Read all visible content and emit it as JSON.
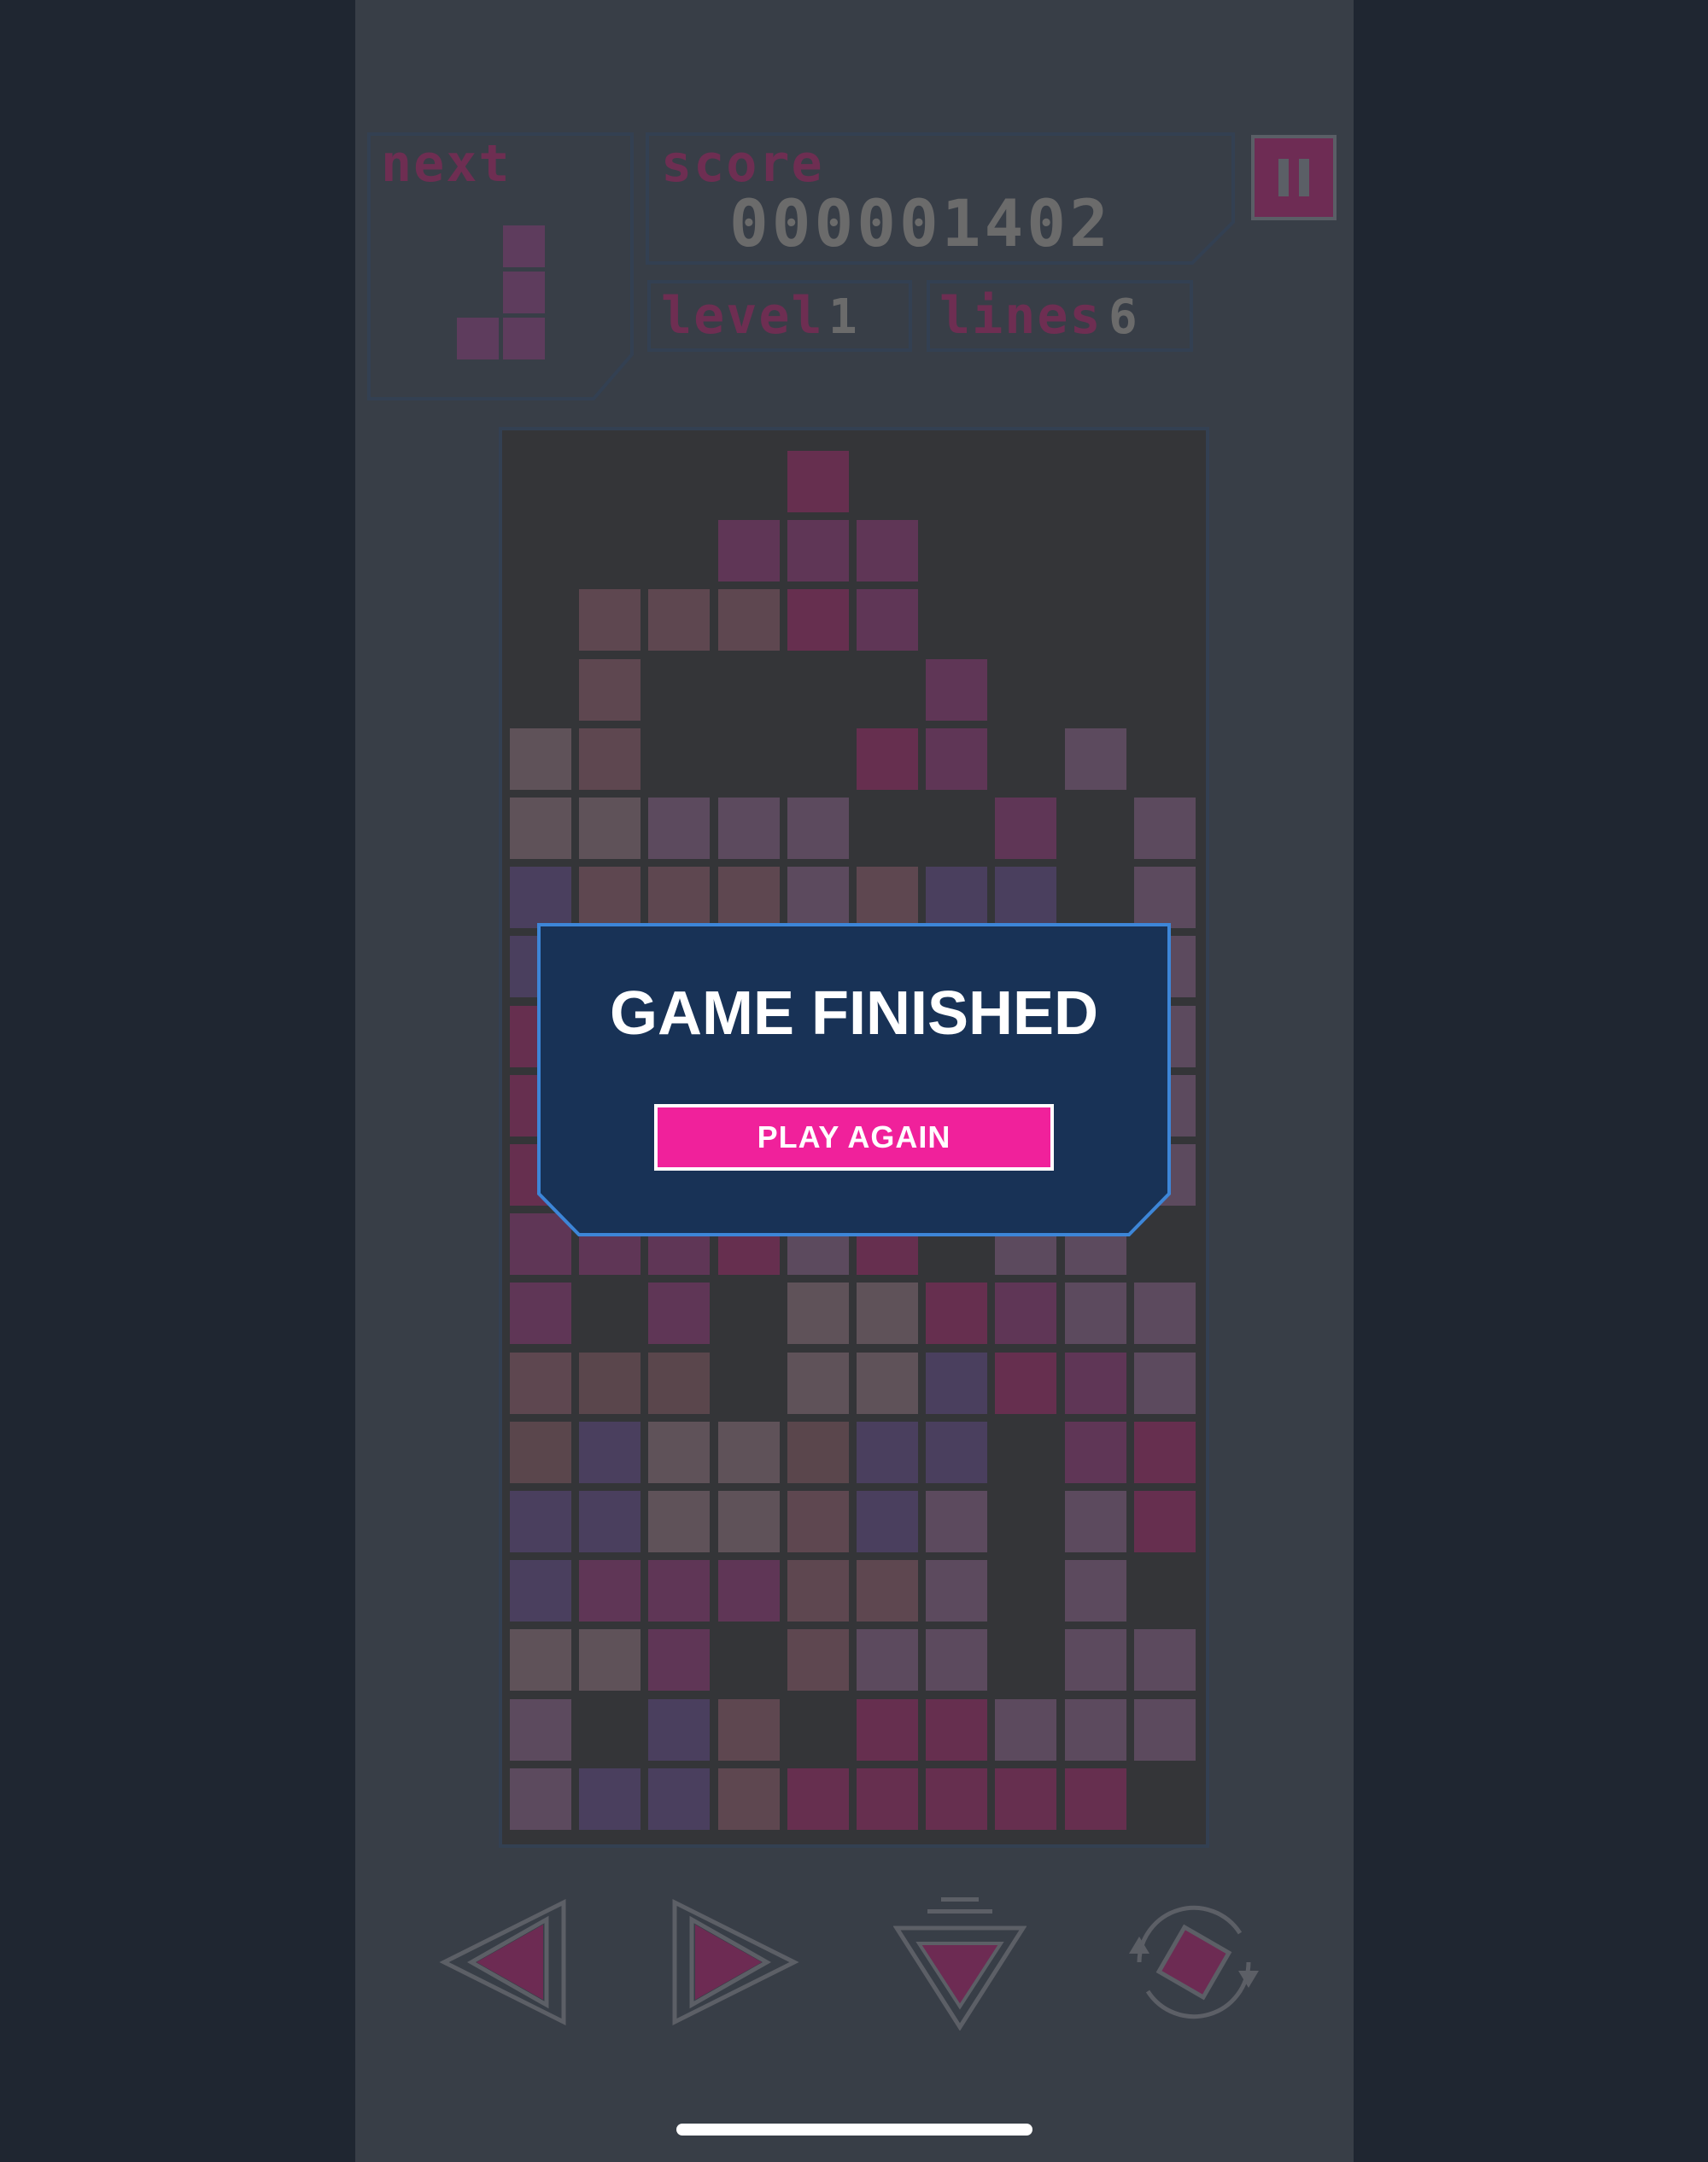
{
  "hud": {
    "next_label": "next",
    "score_label": "score",
    "score_value": "000001402",
    "level_label": "level",
    "level_value": "1",
    "lines_label": "lines",
    "lines_value": "6"
  },
  "pause": {
    "icon": "pause-icon"
  },
  "dialog": {
    "title": "GAME FINISHED",
    "button_label": "PLAY AGAIN"
  },
  "controls": [
    {
      "name": "move-left",
      "icon": "left-arrow-icon"
    },
    {
      "name": "move-right",
      "icon": "right-arrow-icon"
    },
    {
      "name": "drop",
      "icon": "drop-down-icon"
    },
    {
      "name": "rotate",
      "icon": "rotate-icon"
    }
  ],
  "next_piece": {
    "shape": "J",
    "cells": [
      [
        0,
        1
      ],
      [
        1,
        1
      ],
      [
        2,
        0
      ],
      [
        2,
        1
      ]
    ],
    "color": "#5e3c5d"
  },
  "board": {
    "columns": 10,
    "rows": 20,
    "palette": {
      "p": "#5f3656",
      "r": "#662f4f",
      "b": "#5c4a5e",
      "m": "#5b4052",
      "n": "#4a3f5e",
      "k": "#5f5259",
      "w": "#5e4750",
      "s": "#5a464c",
      "c": "#6a3a5a"
    },
    "grid": [
      "....r.....",
      "...ppp....",
      ".www rp....",
      ".w....p...",
      "kw...rp.b.",
      "kkbbb..p.b",
      "nwwwbwnn.b",
      "nkwwbwnn.b",
      "rwwwbwnn.b",
      "rwwwbwnn.b",
      "rwwwbwnn.b",
      "ppprbr.bb.",
      "p.p.kkrpbb",
      "wss.kknrpb",
      "snkks nn.pr",
      "nnkkwnb.br",
      "nppp wwb.b.",
      "kkp.wbb.bb",
      "b.nw.rrbbb",
      "bnnwrrrrr."
    ]
  }
}
